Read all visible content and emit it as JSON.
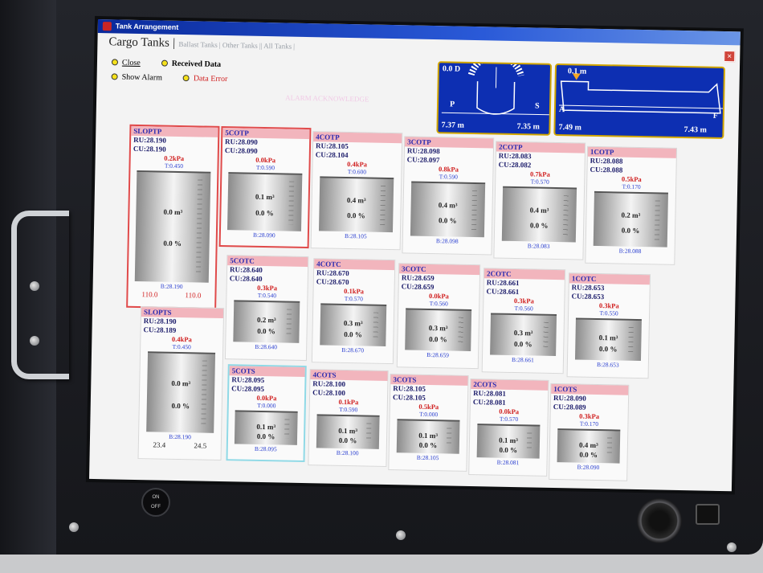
{
  "window": {
    "title": "Tank Arrangement",
    "close_label": "×"
  },
  "tabs": {
    "active": "Cargo Tanks",
    "others": [
      "Ballast Tanks",
      "Other Tanks",
      "All Tanks"
    ]
  },
  "legend": {
    "close": "Close",
    "received": "Received Data",
    "show_alarm": "Show Alarm",
    "data_error": "Data Error"
  },
  "alarm_text": "ALARM ACKNOWLEDGE",
  "gauge_front": {
    "top_left": "0.0 D",
    "port": "P",
    "stbd": "S",
    "left_draft": "7.37 m",
    "right_draft": "7.35 m"
  },
  "gauge_side": {
    "top": "0.1 m",
    "aft": "A",
    "fore": "F",
    "left_draft": "7.49 m",
    "right_draft": "7.43 m"
  },
  "tanks": {
    "slotp": {
      "name": "SLOPTP",
      "ru": "RU:28.190",
      "cu": "CU:28.190",
      "kpa": "0.2kPa",
      "t": "T:0.450",
      "m3": "0.0 m³",
      "pct": "0.0 %",
      "b": "B:28.190",
      "x1": "110.0",
      "x2": "110.0"
    },
    "c5p": {
      "name": "5COTP",
      "ru": "RU:28.090",
      "cu": "CU:28.090",
      "kpa": "0.0kPa",
      "t": "T:0.590",
      "m3": "0.1 m³",
      "pct": "0.0 %",
      "b": "B:28.090"
    },
    "c4p": {
      "name": "4COTP",
      "ru": "RU:28.105",
      "cu": "CU:28.104",
      "kpa": "0.4kPa",
      "t": "T:0.600",
      "m3": "0.4 m³",
      "pct": "0.0 %",
      "b": "B:28.105"
    },
    "c3p": {
      "name": "3COTP",
      "ru": "RU:28.098",
      "cu": "CU:28.097",
      "kpa": "0.8kPa",
      "t": "T:0.590",
      "m3": "0.4 m³",
      "pct": "0.0 %",
      "b": "B:28.098"
    },
    "c2p": {
      "name": "2COTP",
      "ru": "RU:28.083",
      "cu": "CU:28.082",
      "kpa": "0.7kPa",
      "t": "T:0.570",
      "m3": "0.4 m³",
      "pct": "0.0 %",
      "b": "B:28.083"
    },
    "c1p": {
      "name": "1COTP",
      "ru": "RU:28.088",
      "cu": "CU:28.088",
      "kpa": "0.5kPa",
      "t": "T:0.170",
      "m3": "0.2 m³",
      "pct": "0.0 %",
      "b": "B:28.088"
    },
    "c5c": {
      "name": "5COTC",
      "ru": "RU:28.640",
      "cu": "CU:28.640",
      "kpa": "0.3kPa",
      "t": "T:0.540",
      "m3": "0.2 m³",
      "pct": "0.0 %",
      "b": "B:28.640"
    },
    "c4c": {
      "name": "4COTC",
      "ru": "RU:28.670",
      "cu": "CU:28.670",
      "kpa": "0.1kPa",
      "t": "T:0.570",
      "m3": "0.3 m³",
      "pct": "0.0 %",
      "b": "B:28.670"
    },
    "c3c": {
      "name": "3COTC",
      "ru": "RU:28.659",
      "cu": "CU:28.659",
      "kpa": "0.0kPa",
      "t": "T:0.560",
      "m3": "0.3 m³",
      "pct": "0.0 %",
      "b": "B:28.659"
    },
    "c2c": {
      "name": "2COTC",
      "ru": "RU:28.661",
      "cu": "CU:28.661",
      "kpa": "0.3kPa",
      "t": "T:0.560",
      "m3": "0.3 m³",
      "pct": "0.0 %",
      "b": "B:28.661"
    },
    "c1c": {
      "name": "1COTC",
      "ru": "RU:28.653",
      "cu": "CU:28.653",
      "kpa": "0.3kPa",
      "t": "T:0.550",
      "m3": "0.1 m³",
      "pct": "0.0 %",
      "b": "B:28.653"
    },
    "slots": {
      "name": "SLOPTS",
      "ru": "RU:28.190",
      "cu": "CU:28.189",
      "kpa": "0.4kPa",
      "t": "T:0.450",
      "m3": "0.0 m³",
      "pct": "0.0 %",
      "b": "B:28.190",
      "x1": "23.4",
      "x2": "24.5"
    },
    "c5s": {
      "name": "5COTS",
      "ru": "RU:28.095",
      "cu": "CU:28.095",
      "kpa": "0.0kPa",
      "t": "T:0.000",
      "m3": "0.1 m³",
      "pct": "0.0 %",
      "b": "B:28.095"
    },
    "c4s": {
      "name": "4COTS",
      "ru": "RU:28.100",
      "cu": "CU:28.100",
      "kpa": "0.1kPa",
      "t": "T:0.590",
      "m3": "0.1 m³",
      "pct": "0.0 %",
      "b": "B:28.100"
    },
    "c3s": {
      "name": "3COTS",
      "ru": "RU:28.105",
      "cu": "CU:28.105",
      "kpa": "0.5kPa",
      "t": "T:0.000",
      "m3": "0.1 m³",
      "pct": "0.0 %",
      "b": "B:28.105"
    },
    "c2s": {
      "name": "2COTS",
      "ru": "RU:28.081",
      "cu": "CU:28.081",
      "kpa": "0.0kPa",
      "t": "T:0.570",
      "m3": "0.1 m³",
      "pct": "0.0 %",
      "b": "B:28.081"
    },
    "c1s": {
      "name": "1COTS",
      "ru": "RU:28.090",
      "cu": "CU:28.089",
      "kpa": "0.3kPa",
      "t": "T:0.170",
      "m3": "0.4 m³",
      "pct": "0.0 %",
      "b": "B:28.090"
    }
  },
  "hardware": {
    "power_on": "ON",
    "power_off": "OFF"
  },
  "colors": {
    "titlebar": "#0a2a9c",
    "gauge_bg": "#0d2fb2",
    "tank_header": "#f2b5bd",
    "alarm_red": "#d02020"
  }
}
